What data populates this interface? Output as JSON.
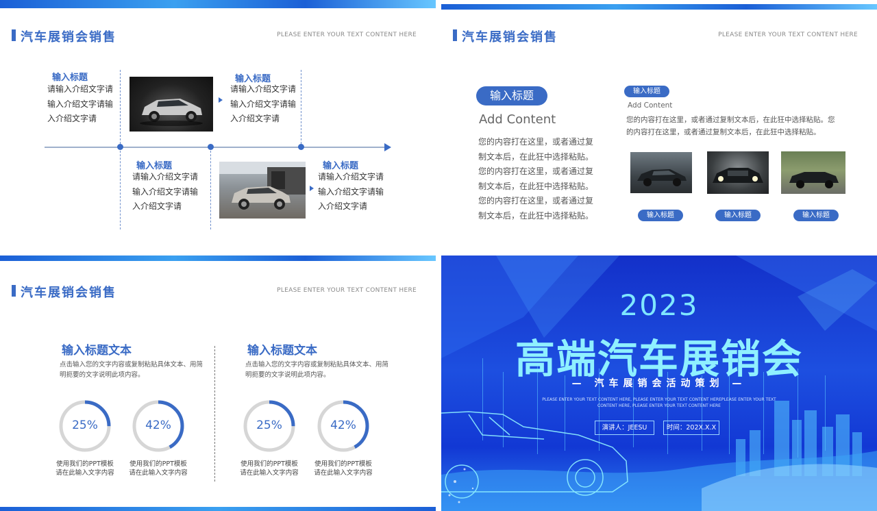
{
  "header": {
    "title": "汽车展销会销售",
    "subtitle": "PLEASE ENTER YOUR TEXT CONTENT HERE"
  },
  "timeline": {
    "items": [
      {
        "title": "输入标题",
        "lines": [
          "请输入介绍文字请",
          "输入介绍文字请输",
          "入介绍文字请"
        ]
      },
      {
        "title": "输入标题",
        "lines": [
          "请输入介绍文字请",
          "输入介绍文字请输",
          "入介绍文字请"
        ]
      },
      {
        "title": "输入标题",
        "lines": [
          "请输入介绍文字请",
          "输入介绍文字请输",
          "入介绍文字请"
        ]
      },
      {
        "title": "输入标题",
        "lines": [
          "请输入介绍文字请",
          "输入介绍文字请输",
          "入介绍文字请"
        ]
      }
    ]
  },
  "content": {
    "left_pill": "输入标题",
    "left_heading": "Add Content",
    "left_lines": [
      "您的内容打在这里，或者通过复",
      "制文本后，在此狂中选择粘贴。",
      "您的内容打在这里，或者通过复",
      "制文本后，在此狂中选择粘贴。",
      "您的内容打在这里，或者通过复",
      "制文本后，在此狂中选择粘贴。"
    ],
    "right_pill": "输入标题",
    "right_heading": "Add Content",
    "right_lines": [
      "您的内容打在这里，或者通过复制文本后，在此狂中选择粘贴。您",
      "的内容打在这里，或者通过复制文本后，在此狂中选择粘贴。"
    ],
    "photo_labels": [
      "输入标题",
      "输入标题",
      "输入标题"
    ]
  },
  "stats": {
    "columns": [
      {
        "heading": "输入标题文本",
        "desc_lines": [
          "点击输入您的文字内容或复制粘贴具体文本、用简",
          "明扼要的文字说明此项内容。"
        ]
      },
      {
        "heading": "输入标题文本",
        "desc_lines": [
          "点击输入您的文字内容或复制粘贴具体文本、用简",
          "明扼要的文字说明此项内容。"
        ]
      }
    ],
    "rings": [
      {
        "label": "25%",
        "value": 0.25,
        "cap1": "使用我们的PPT模板",
        "cap2": "请在此输入文字内容"
      },
      {
        "label": "42%",
        "value": 0.42,
        "cap1": "使用我们的PPT模板",
        "cap2": "请在此输入文字内容"
      },
      {
        "label": "25%",
        "value": 0.25,
        "cap1": "使用我们的PPT模板",
        "cap2": "请在此输入文字内容"
      },
      {
        "label": "42%",
        "value": 0.42,
        "cap1": "使用我们的PPT模板",
        "cap2": "请在此输入文字内容"
      }
    ]
  },
  "cover": {
    "year": "2023",
    "title": "高端汽车展销会",
    "subtitle": "— 汽车展销会活动策划 —",
    "english_line1": "PLEASE ENTER YOUR TEXT CONTENT HERE, PLEASE ENTER YOUR TEXT CONTENT HEREPLEASE ENTER YOUR TEXT",
    "english_line2": "CONTENT HERE, PLEASE ENTER YOUR TEXT CONTENT HERE",
    "presenter": "演讲人：JEESU",
    "time": "时间：202X.X.X"
  },
  "colors": {
    "accent": "#3a6bc5",
    "cover_bg": "#1d4fe0",
    "cover_title": "#8ff0ff"
  }
}
